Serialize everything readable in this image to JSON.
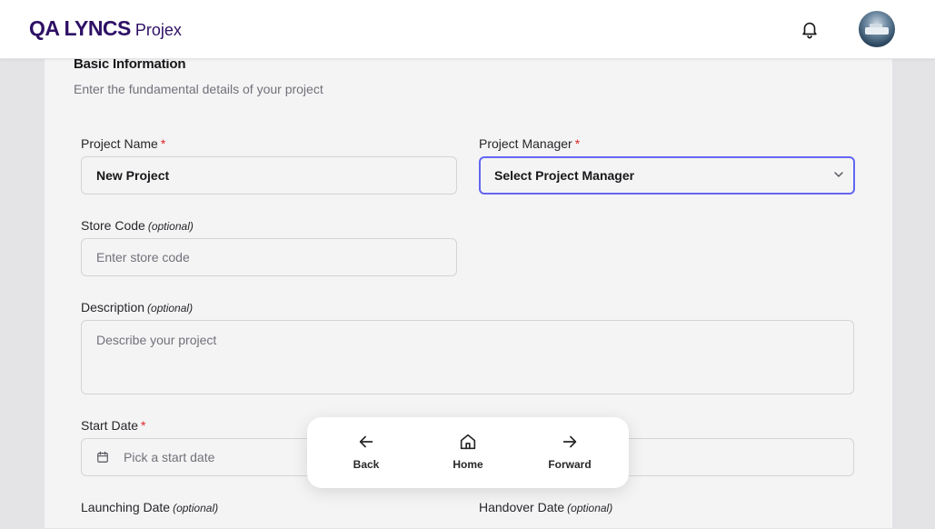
{
  "header": {
    "brand_main": "QA LYNCS",
    "brand_sub": "Projex",
    "notification_icon": "bell-icon",
    "avatar_icon": "user-avatar"
  },
  "form": {
    "section_title": "Basic Information",
    "section_description": "Enter the fundamental details of your project",
    "project_name": {
      "label": "Project Name",
      "required": "*",
      "value": "New Project"
    },
    "project_manager": {
      "label": "Project Manager",
      "required": "*",
      "value": "Select Project Manager"
    },
    "store_code": {
      "label": "Store Code",
      "optional": "(optional)",
      "placeholder": "Enter store code"
    },
    "description": {
      "label": "Description",
      "optional": "(optional)",
      "placeholder": "Describe your project"
    },
    "start_date": {
      "label": "Start Date",
      "required": "*",
      "placeholder": "Pick a start date"
    },
    "launching_date": {
      "label": "Launching Date",
      "optional": "(optional)"
    },
    "handover_date": {
      "label": "Handover Date",
      "optional": "(optional)"
    }
  },
  "nav": {
    "back": "Back",
    "home": "Home",
    "forward": "Forward"
  },
  "colors": {
    "brand": "#2e1065",
    "focus_ring": "#6366f1",
    "required": "#dc2626"
  }
}
